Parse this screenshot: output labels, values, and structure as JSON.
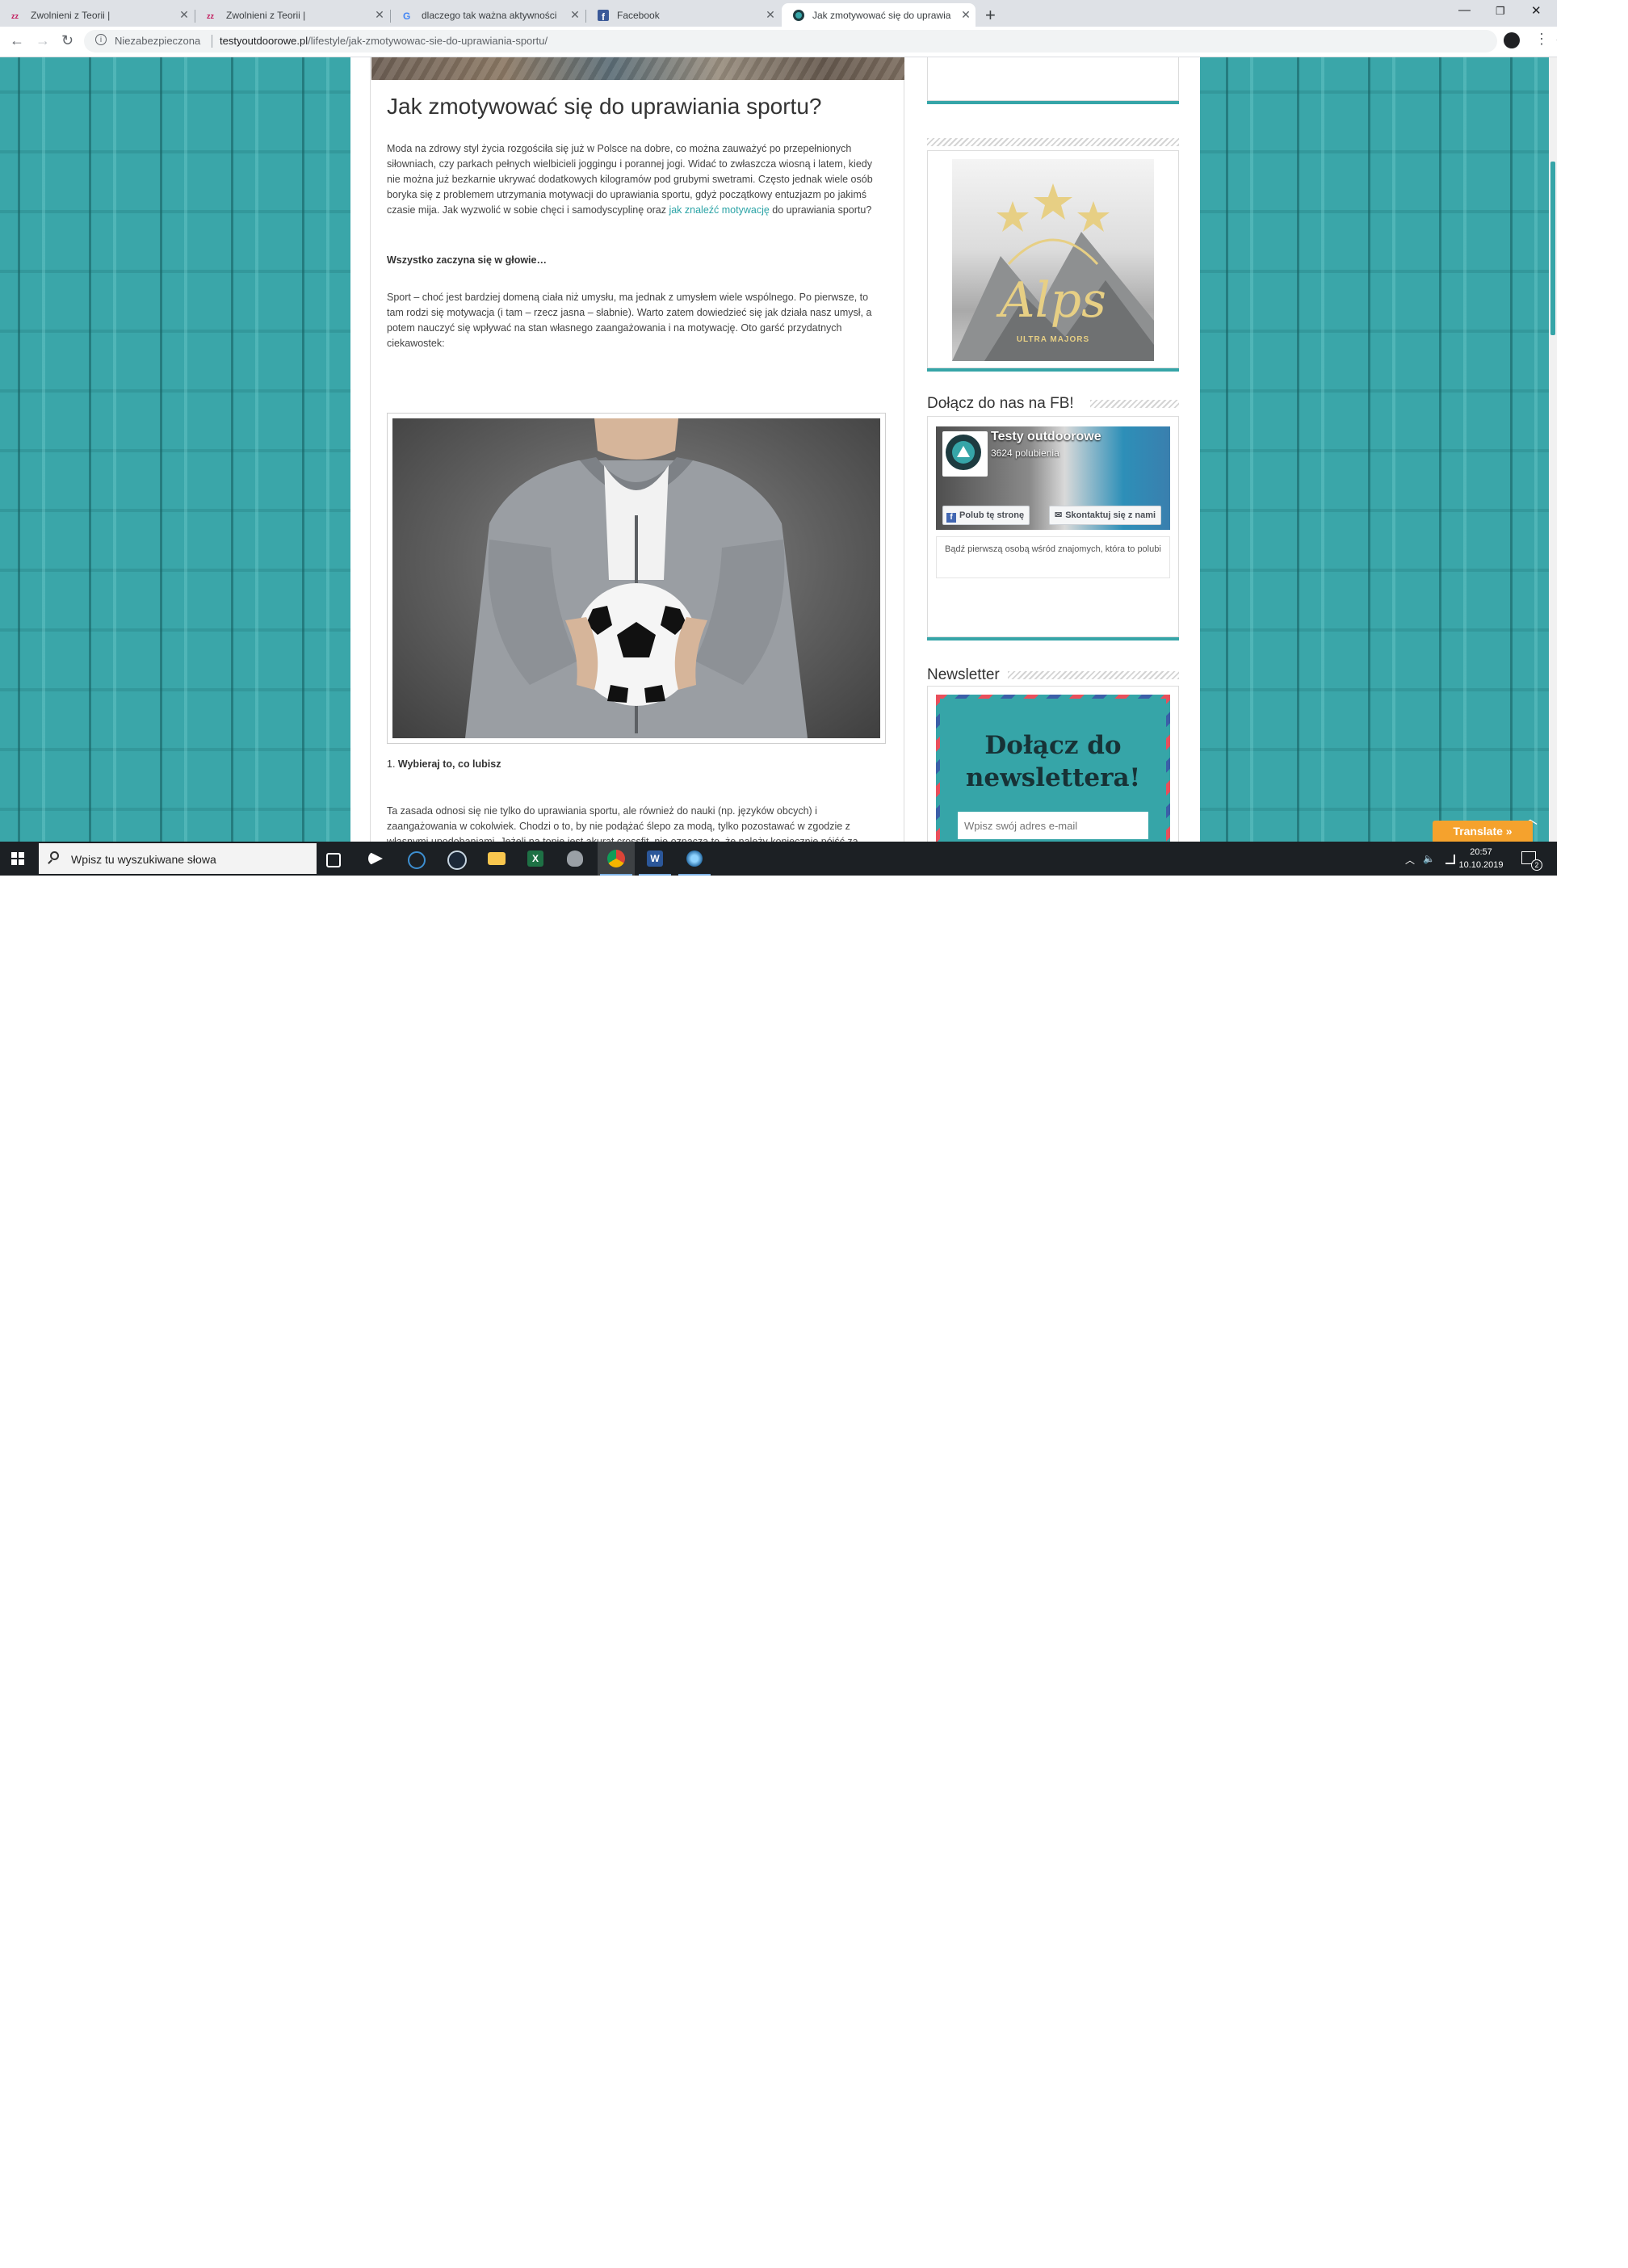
{
  "browser": {
    "tabs": [
      {
        "label": "Zwolnieni z Teorii |",
        "favicon": "zwolnieni-favicon",
        "active": false
      },
      {
        "label": "Zwolnieni z Teorii |",
        "favicon": "zwolnieni-favicon",
        "active": false
      },
      {
        "label": "dlaczego tak ważna aktywności",
        "favicon": "google-favicon",
        "active": false
      },
      {
        "label": "Facebook",
        "favicon": "facebook-favicon",
        "active": false
      },
      {
        "label": "Jak zmotywować się do uprawia",
        "favicon": "testy-outdoorowe-favicon",
        "active": true
      }
    ],
    "new_tab": "+",
    "security_label": "Niezabezpieczona",
    "url_domain": "testyoutdoorowe.pl",
    "url_path": "/lifestyle/jak-zmotywowac-sie-do-uprawiania-sportu/"
  },
  "article": {
    "title": "Jak zmotywować się do uprawiania sportu?",
    "intro": "Moda na zdrowy styl życia rozgościła się już w Polsce na dobre, co można zauważyć po przepełnionych siłowniach, czy parkach pełnych wielbicieli joggingu i porannej jogi. Widać to zwłaszcza wiosną i latem, kiedy nie można już bezkarnie ukrywać dodatkowych kilogramów pod grubymi swetrami. Często jednak wiele osób boryka się z problemem utrzymania motywacji do uprawiania sportu, gdyż początkowy entuzjazm po jakimś czasie mija. Jak wyzwolić w sobie chęci i samodyscyplinę oraz",
    "intro_link": "jak znaleźć motywację",
    "intro_tail": "do uprawiania sportu?",
    "heading_bold": "Wszystko zaczyna się w głowie…",
    "para2": "Sport – choć jest bardziej domeną ciała niż umysłu, ma jednak z umysłem wiele wspólnego. Po pierwsze, to tam rodzi się motywacja (i tam – rzecz jasna – słabnie). Warto zatem dowiedzieć się jak działa nasz umysł, a potem nauczyć się wpływać na stan własnego zaangażowania i na motywację. Oto garść przydatnych ciekawostek:",
    "list_item_1": "Wybieraj to, co lubisz",
    "para3": "Ta zasada odnosi się nie tylko do uprawiania sportu, ale również do nauki (np. języków obcych) i zaangażowania w cokolwiek. Chodzi o to, by nie podążać ślepo za modą, tylko pozostawać w zgodzie z własnymi upodobaniami. Jeżeli na topie jest akurat crossfit, nie oznacza to, że należy koniecznie pójść za tłumem. Zwłaszcza, jeśli największą frajdę sprawia Wam jazda na rowerze, tai chi, albo pływanie."
  },
  "sidebar": {
    "alps_text": "Alps",
    "alps_subtext": "ULTRA MAJORS",
    "fb_title": "Dołącz do nas na FB!",
    "fb_page_name": "Testy outdoorowe",
    "fb_likes": "3624 polubienia",
    "fb_like_button": "Polub tę stronę",
    "fb_contact_button": "Skontaktuj się z nami",
    "fb_friends_text": "Bądź pierwszą osobą wśród znajomych, która to polubi",
    "newsletter_title": "Newsletter",
    "newsletter_heading": "Dołącz do newslettera!",
    "newsletter_placeholder": "Wpisz swój adres e-mail"
  },
  "translate_label": "Translate »",
  "taskbar": {
    "search_placeholder": "Wpisz tu wyszukiwane słowa",
    "time": "20:57",
    "date": "10.10.2019",
    "notifications": "2"
  },
  "colors": {
    "accent": "#36a5a8",
    "link": "#2ba3a6",
    "translate": "#f5a22d"
  }
}
